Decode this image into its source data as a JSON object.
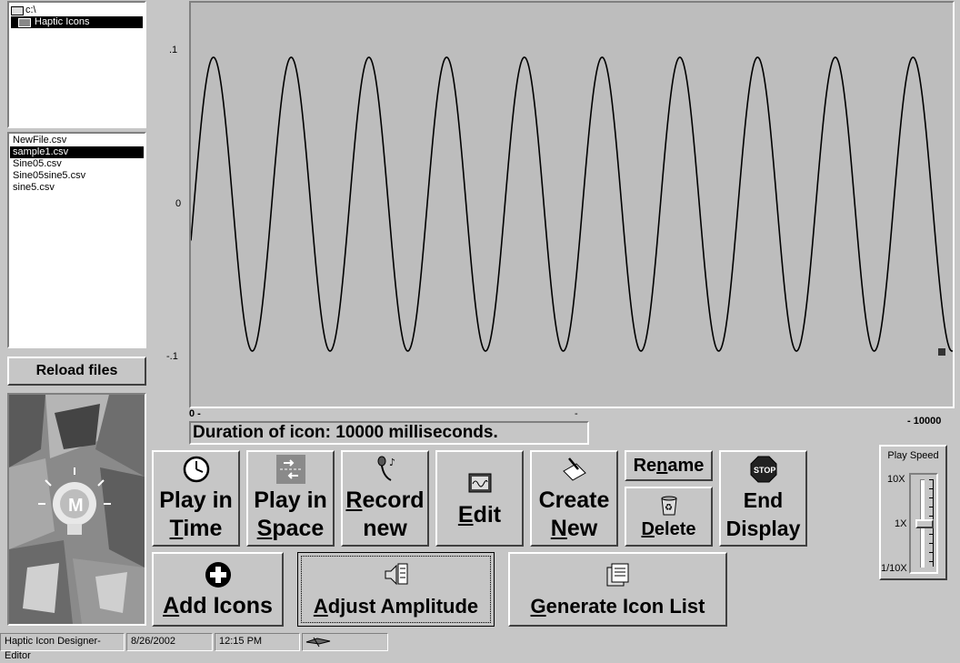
{
  "folder_tree": {
    "items": [
      {
        "label": "c:\\",
        "selected": false,
        "indent": 0
      },
      {
        "label": "Haptic Icons",
        "selected": true,
        "indent": 1
      }
    ]
  },
  "file_list": {
    "items": [
      {
        "label": "NewFile.csv",
        "selected": false
      },
      {
        "label": "sample1.csv",
        "selected": true
      },
      {
        "label": "Sine05.csv",
        "selected": false
      },
      {
        "label": "Sine05sine5.csv",
        "selected": false
      },
      {
        "label": "sine5.csv",
        "selected": false
      }
    ]
  },
  "reload_button": "Reload files",
  "chart": {
    "y_ticks": [
      ".1",
      "0",
      "-.1"
    ],
    "x_start": "0 -",
    "x_end": "- 10000",
    "x_mid_mark": "-",
    "duration_text": "Duration of icon:  10000 milliseconds."
  },
  "chart_data": {
    "type": "line",
    "title": "",
    "xlabel": "",
    "ylabel": "",
    "xlim": [
      0,
      10000
    ],
    "ylim": [
      -0.1,
      0.1
    ],
    "series": [
      {
        "function": "sine",
        "amplitude": 0.097,
        "frequency_hz": 0.00098,
        "phase_offset": 0.02,
        "color": "#000000"
      }
    ]
  },
  "buttons": {
    "play_time": {
      "line1": "Play in ",
      "line2_u": "T",
      "line2_rest": "ime",
      "icon": "clock-icon"
    },
    "play_space": {
      "line1": "Play in ",
      "line2_u": "S",
      "line2_rest": "pace",
      "icon": "arrows-icon"
    },
    "record": {
      "line1_u": "R",
      "line1_rest": "ecord",
      "line2": "new",
      "icon": "microphone-icon"
    },
    "edit": {
      "line1_u": "E",
      "line1_rest": "dit",
      "icon": "monitor-icon"
    },
    "create": {
      "line1": "Create",
      "line2_u": "N",
      "line2_rest": "ew",
      "icon": "notepad-icon"
    },
    "rename": {
      "pre": "Re",
      "u": "n",
      "post": "ame"
    },
    "delete": {
      "u": "D",
      "rest": "elete",
      "icon": "recycle-bin-icon"
    },
    "end_display": {
      "line1": "End",
      "line2": "Display",
      "icon": "stop-sign-icon",
      "sign_text": "STOP"
    },
    "add_icons": {
      "u": "A",
      "rest": "dd Icons",
      "icon": "plus-circle-icon"
    },
    "adjust": {
      "u": "A",
      "rest": "djust Amplitude",
      "icon": "speaker-icon"
    },
    "generate": {
      "u": "G",
      "rest": "enerate Icon List",
      "icon": "file-list-icon"
    }
  },
  "play_speed": {
    "title": "Play Speed",
    "labels": [
      "10X",
      "1X",
      "1/10X"
    ],
    "level": "1X"
  },
  "status_bar": {
    "app": "Haptic Icon Designer-Editor",
    "date": "8/26/2002",
    "time": "12:15 PM"
  }
}
